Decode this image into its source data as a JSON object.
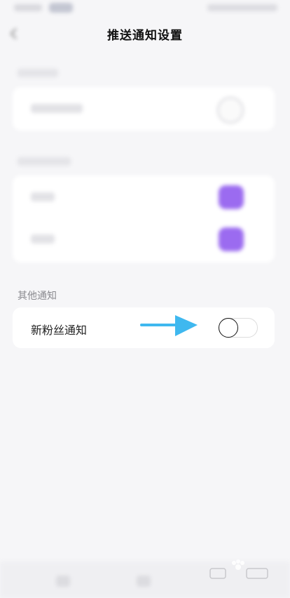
{
  "header": {
    "title": "推送通知设置",
    "back_icon": "chevron-left-icon"
  },
  "sections": {
    "other": {
      "label": "其他通知",
      "items": [
        {
          "label": "新粉丝通知",
          "toggle_on": false
        }
      ]
    }
  },
  "colors": {
    "accent": "#9b6bf0",
    "arrow": "#3fb8ef",
    "background": "#f6f6f8"
  }
}
